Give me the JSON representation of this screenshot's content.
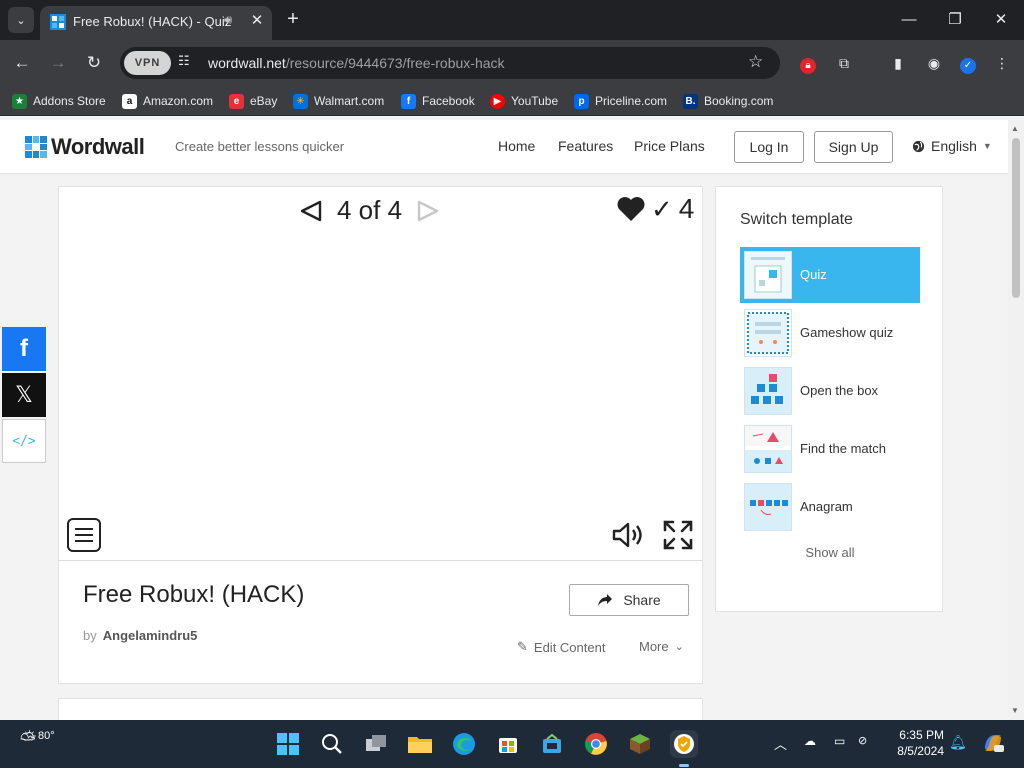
{
  "browser": {
    "tab_title": "Free Robux! (HACK) - Quiz",
    "url_host": "wordwall.net",
    "url_path": "/resource/9444673/free-robux-hack",
    "vpn_label": "VPN",
    "bookmarks": [
      {
        "label": "Addons Store",
        "color": "#1a7f37"
      },
      {
        "label": "Amazon.com",
        "color": "#ffffff"
      },
      {
        "label": "eBay",
        "color": "#e53238"
      },
      {
        "label": "Walmart.com",
        "color": "#0071dc"
      },
      {
        "label": "Facebook",
        "color": "#1877f2"
      },
      {
        "label": "YouTube",
        "color": "#ff0000"
      },
      {
        "label": "Priceline.com",
        "color": "#0068ef"
      },
      {
        "label": "Booking.com",
        "color": "#003580"
      }
    ]
  },
  "header": {
    "logo_text": "Wordwall",
    "tagline": "Create better lessons quicker",
    "nav": [
      "Home",
      "Features",
      "Price Plans"
    ],
    "login_label": "Log In",
    "signup_label": "Sign Up",
    "language": "English"
  },
  "activity": {
    "pager_text": "4 of 4",
    "score": "4",
    "title": "Free Robux! (HACK)",
    "by_label": "by",
    "author": "Angelamindru5",
    "share_label": "Share",
    "edit_label": "Edit Content",
    "more_label": "More"
  },
  "templates": {
    "heading": "Switch template",
    "items": [
      {
        "label": "Quiz",
        "active": true
      },
      {
        "label": "Gameshow quiz",
        "active": false
      },
      {
        "label": "Open the box",
        "active": false
      },
      {
        "label": "Find the match",
        "active": false
      },
      {
        "label": "Anagram",
        "active": false
      }
    ],
    "show_all": "Show all"
  },
  "taskbar": {
    "temperature": "80°",
    "time": "6:35 PM",
    "date": "8/5/2024"
  },
  "colors": {
    "accent": "#3ab6ef",
    "brand": "#1a8bd6",
    "facebook": "#1877f2",
    "x": "#111111"
  }
}
